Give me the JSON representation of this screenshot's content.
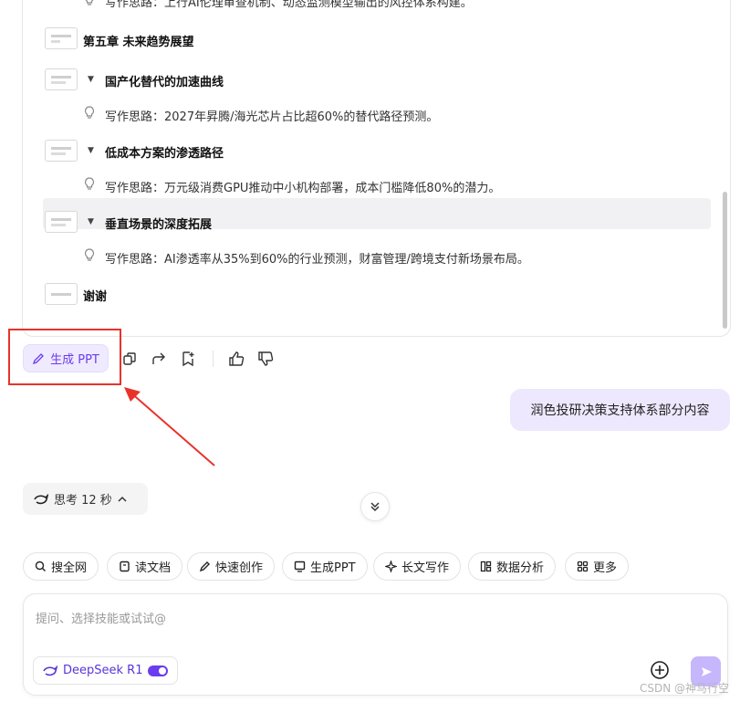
{
  "outline": {
    "top_idea": "写作思路：上行AI伦理审查机制、动态监测模型输出的风控体系构建。",
    "chapter5": "第五章 未来趋势展望",
    "sections": [
      {
        "title": "国产化替代的加速曲线",
        "idea": "写作思路：2027年昇腾/海光芯片占比超60%的替代路径预测。"
      },
      {
        "title": "低成本方案的渗透路径",
        "idea": "写作思路：万元级消费GPU推动中小机构部署，成本门槛降低80%的潜力。"
      },
      {
        "title": "垂直场景的深度拓展",
        "idea": "写作思路：AI渗透率从35%到60%的行业预测，财富管理/跨境支付新场景布局。"
      }
    ],
    "thanks": "谢谢"
  },
  "actions": {
    "gen_ppt_label": "生成 PPT"
  },
  "user_message": "润色投研决策支持体系部分内容",
  "thinking": {
    "label": "思考 12 秒"
  },
  "tools": [
    "搜全网",
    "读文档",
    "快速创作",
    "生成PPT",
    "长文写作",
    "数据分析",
    "更多"
  ],
  "input": {
    "placeholder": "提问、选择技能或试试@",
    "model": "DeepSeek R1"
  },
  "watermark": "CSDN @神马行空",
  "colors": {
    "accent": "#6a3cf0",
    "annotation_red": "#e8332b",
    "bubble": "#ede8fd"
  }
}
